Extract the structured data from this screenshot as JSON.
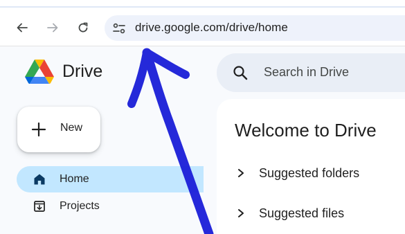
{
  "browser": {
    "url": "drive.google.com/drive/home",
    "icons": {
      "back": "arrow-left-icon",
      "forward": "arrow-right-icon",
      "reload": "reload-icon",
      "site_info": "tune-icon"
    }
  },
  "app": {
    "brand": "Drive",
    "search": {
      "placeholder": "Search in Drive"
    },
    "new_button": {
      "label": "New"
    },
    "nav": [
      {
        "label": "Home",
        "icon": "home-icon",
        "active": true
      },
      {
        "label": "Projects",
        "icon": "projects-icon",
        "active": false
      }
    ],
    "main": {
      "title": "Welcome to Drive",
      "sections": [
        {
          "label": "Suggested folders"
        },
        {
          "label": "Suggested files"
        }
      ]
    }
  },
  "colors": {
    "accent_active": "#c2e7ff",
    "search_bg": "#e9eef6",
    "omnibox_bg": "#eef2fb",
    "annotation_arrow": "#1a1ed8"
  }
}
